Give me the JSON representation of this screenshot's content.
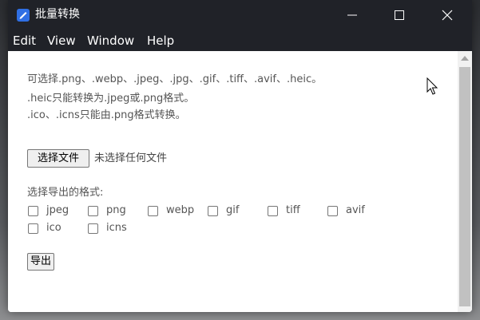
{
  "window": {
    "title": "批量转换",
    "icon": "app-logo-icon",
    "controls": [
      "minimize-icon",
      "maximize-icon",
      "close-icon"
    ]
  },
  "menu": {
    "items": [
      "Edit",
      "View",
      "Window",
      "Help"
    ]
  },
  "info": {
    "line1": "可选择.png、.webp、.jpeg、.jpg、.gif、.tiff、.avif、.heic。",
    ".line2": "",
    "line2": ".heic只能转换为.jpeg或.png格式。",
    "line3": ".ico、.icns只能由.png格式转换。"
  },
  "file": {
    "button_label": "选择文件",
    "status": "未选择任何文件"
  },
  "formats": {
    "label": "选择导出的格式:",
    "options": [
      {
        "label": "jpeg",
        "checked": false
      },
      {
        "label": "png",
        "checked": false
      },
      {
        "label": "webp",
        "checked": false
      },
      {
        "label": "gif",
        "checked": false
      },
      {
        "label": "tiff",
        "checked": false
      },
      {
        "label": "avif",
        "checked": false
      },
      {
        "label": "ico",
        "checked": false
      },
      {
        "label": "icns",
        "checked": false
      }
    ]
  },
  "export": {
    "button_label": "导出"
  },
  "colors": {
    "titlebar": "#202228",
    "accent": "#2f6fe4"
  }
}
